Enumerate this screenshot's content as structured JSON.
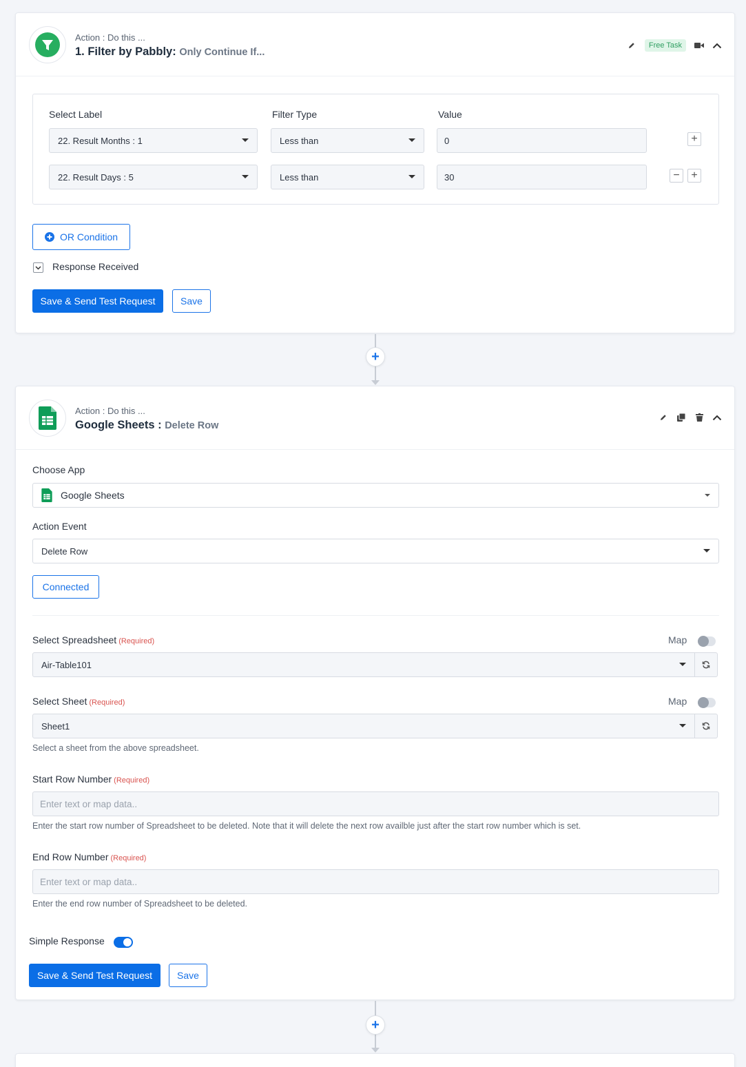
{
  "step1": {
    "subtitle": "Action : Do this ...",
    "title": "1. Filter by Pabbly:",
    "title_detail": "Only Continue If...",
    "badge": "Free Task",
    "headers": {
      "label": "Select Label",
      "type": "Filter Type",
      "value": "Value"
    },
    "rows": [
      {
        "label": "22. Result Months : 1",
        "type": "Less than",
        "value": "0"
      },
      {
        "label": "22. Result Days : 5",
        "type": "Less than",
        "value": "30"
      }
    ],
    "or_condition": "OR Condition",
    "response_received": "Response Received",
    "save_send": "Save & Send Test Request",
    "save": "Save"
  },
  "step2": {
    "subtitle": "Action : Do this ...",
    "title": "Google Sheets :",
    "title_detail": "Delete Row",
    "choose_app_label": "Choose App",
    "choose_app_value": "Google Sheets",
    "action_event_label": "Action Event",
    "action_event_value": "Delete Row",
    "connected": "Connected",
    "required": "(Required)",
    "map": "Map",
    "spreadsheet_label": "Select Spreadsheet",
    "spreadsheet_value": "Air-Table101",
    "sheet_label": "Select Sheet",
    "sheet_value": "Sheet1",
    "sheet_help": "Select a sheet from the above spreadsheet.",
    "start_row_label": "Start Row Number",
    "start_row_placeholder": "Enter text or map data..",
    "start_row_help": "Enter the start row number of Spreadsheet to be deleted. Note that it will delete the next row availble just after the start row number which is set.",
    "end_row_label": "End Row Number",
    "end_row_placeholder": "Enter text or map data..",
    "end_row_help": "Enter the end row number of Spreadsheet to be deleted.",
    "simple_response": "Simple Response",
    "save_send": "Save & Send Test Request",
    "save": "Save"
  },
  "colors": {
    "accent": "#0b6ee6",
    "pabbly_green": "#27ae60",
    "sheets_green": "#0f9d58",
    "required": "#d9534f"
  },
  "icons": [
    "filter-icon",
    "pencil-icon",
    "video-icon",
    "chevron-up-icon",
    "plus-icon",
    "minus-icon",
    "plus-circle-icon",
    "checkbox-icon",
    "sheets-icon",
    "copy-icon",
    "trash-icon",
    "refresh-icon",
    "dropdown-caret-icon"
  ]
}
